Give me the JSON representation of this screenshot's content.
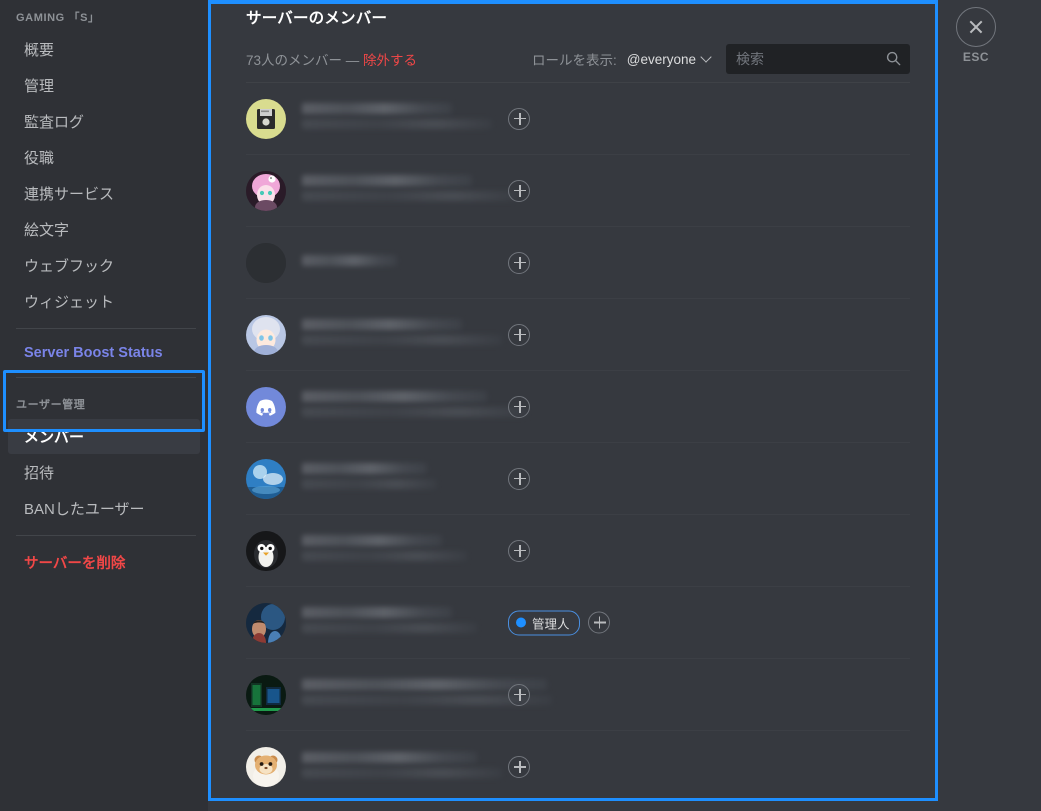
{
  "sidebar": {
    "server_name": "GAMING 「S」",
    "items": [
      {
        "label": "概要",
        "type": "nav"
      },
      {
        "label": "管理",
        "type": "nav"
      },
      {
        "label": "監査ログ",
        "type": "nav"
      },
      {
        "label": "役職",
        "type": "nav"
      },
      {
        "label": "連携サービス",
        "type": "nav"
      },
      {
        "label": "絵文字",
        "type": "nav"
      },
      {
        "label": "ウェブフック",
        "type": "nav"
      },
      {
        "label": "ウィジェット",
        "type": "nav"
      }
    ],
    "boost_label": "Server Boost Status",
    "user_management": {
      "header": "ユーザー管理",
      "items": [
        {
          "label": "メンバー",
          "active": true
        },
        {
          "label": "招待",
          "active": false
        },
        {
          "label": "BANしたユーザー",
          "active": false
        }
      ]
    },
    "delete_label": "サーバーを削除"
  },
  "header": {
    "title": "サーバーのメンバー",
    "member_count_text": "73人のメンバー — ",
    "kick_label": "除外する",
    "role_filter_label": "ロールを表示:",
    "role_filter_value": "@everyone",
    "search_placeholder": "検索",
    "search_value": ""
  },
  "members": [
    {
      "avatar_bg": "#d9dc8f",
      "avatar_kind": "floppy",
      "badge": null
    },
    {
      "avatar_bg": "#3d2b3a",
      "avatar_kind": "anime-pink",
      "badge": null
    },
    {
      "avatar_bg": "#2c2f33",
      "avatar_kind": "empty",
      "badge": null
    },
    {
      "avatar_bg": "#cfd8e8",
      "avatar_kind": "anime-white",
      "badge": null
    },
    {
      "avatar_bg": "#7289da",
      "avatar_kind": "discord-clyde",
      "badge": null
    },
    {
      "avatar_bg": "#2b6fb0",
      "avatar_kind": "sky",
      "badge": null
    },
    {
      "avatar_bg": "#1d1f22",
      "avatar_kind": "penguin",
      "badge": null
    },
    {
      "avatar_bg": "#1b3a5c",
      "avatar_kind": "portrait",
      "badge": "管理人"
    },
    {
      "avatar_bg": "#10331f",
      "avatar_kind": "neon",
      "badge": null
    },
    {
      "avatar_bg": "#e8e4db",
      "avatar_kind": "hamster",
      "badge": null
    }
  ],
  "close": {
    "esc_label": "ESC"
  },
  "colors": {
    "accent_blue": "#1e8fff",
    "danger_red": "#f04747",
    "boost_blurple": "#7a84e8",
    "sidebar_bg": "#2f3136",
    "main_bg": "#36393f",
    "input_bg": "#202225"
  }
}
